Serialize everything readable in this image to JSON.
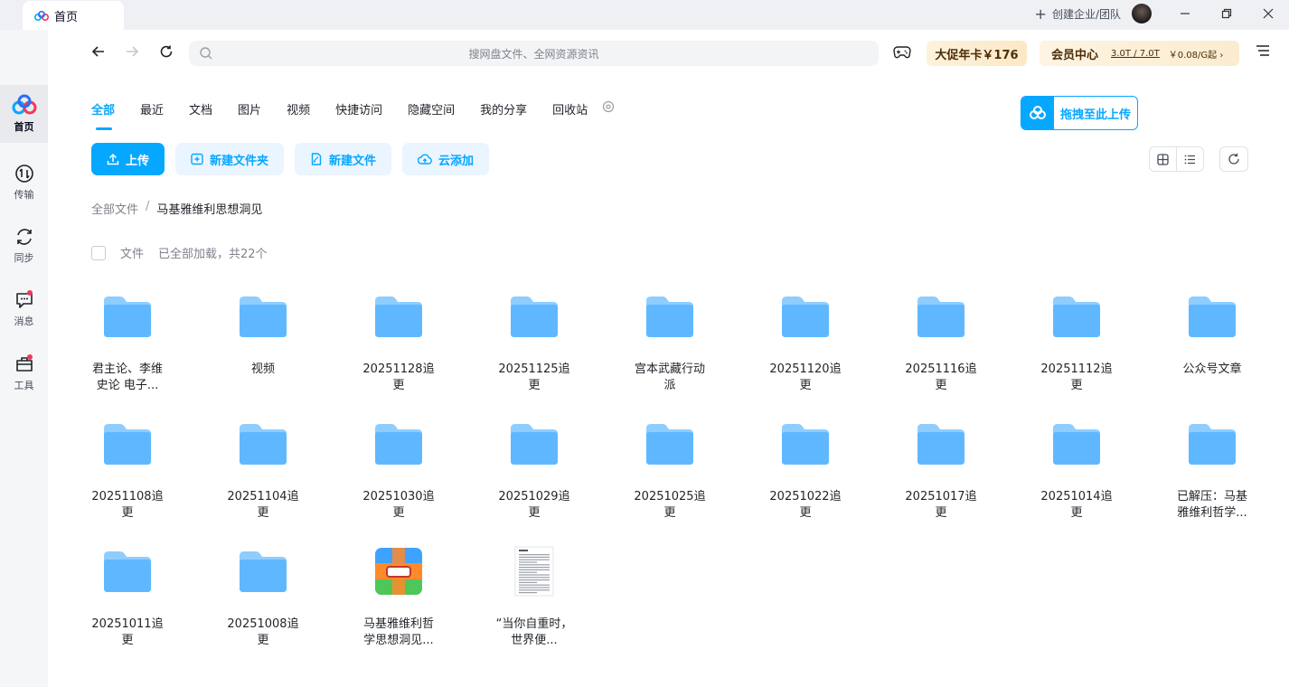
{
  "titlebar": {
    "tab_title": "首页",
    "create_enterprise": "创建企业/团队"
  },
  "sidebar": {
    "items": [
      {
        "label": "首页",
        "icon": "home-cloud-icon"
      },
      {
        "label": "传输",
        "icon": "transfer-icon"
      },
      {
        "label": "同步",
        "icon": "sync-icon"
      },
      {
        "label": "消息",
        "icon": "message-icon"
      },
      {
        "label": "工具",
        "icon": "toolbox-icon"
      }
    ]
  },
  "topbar": {
    "search_placeholder": "搜网盘文件、全网资源资讯",
    "promo_label": "大促年卡￥176",
    "vip_label": "会员中心",
    "vip_capacity": "3.0T / 7.0T",
    "vip_price": "￥0.08/G起 ›"
  },
  "tabs": [
    "全部",
    "最近",
    "文档",
    "图片",
    "视频",
    "快捷访问",
    "隐藏空间",
    "我的分享",
    "回收站"
  ],
  "drag_upload_label": "拖拽至此上传",
  "actions": {
    "upload": "上传",
    "new_folder": "新建文件夹",
    "new_file": "新建文件",
    "cloud_add": "云添加"
  },
  "breadcrumb": {
    "root": "全部文件",
    "separator": "/",
    "current": "马基雅维利思想洞见"
  },
  "list_header": {
    "column": "文件",
    "count": "已全部加载，共22个"
  },
  "files": [
    {
      "name": "君主论、李维史论 电子...",
      "type": "folder"
    },
    {
      "name": "视频",
      "type": "folder"
    },
    {
      "name": "20251128追更",
      "type": "folder"
    },
    {
      "name": "20251125追更",
      "type": "folder"
    },
    {
      "name": "宫本武藏行动派",
      "type": "folder"
    },
    {
      "name": "20251120追更",
      "type": "folder"
    },
    {
      "name": "20251116追更",
      "type": "folder"
    },
    {
      "name": "20251112追更",
      "type": "folder"
    },
    {
      "name": "公众号文章",
      "type": "folder"
    },
    {
      "name": "20251108追更",
      "type": "folder"
    },
    {
      "name": "20251104追更",
      "type": "folder"
    },
    {
      "name": "20251030追更",
      "type": "folder"
    },
    {
      "name": "20251029追更",
      "type": "folder"
    },
    {
      "name": "20251025追更",
      "type": "folder"
    },
    {
      "name": "20251022追更",
      "type": "folder"
    },
    {
      "name": "20251017追更",
      "type": "folder"
    },
    {
      "name": "20251014追更",
      "type": "folder"
    },
    {
      "name": "已解压：马基雅维利哲学...",
      "type": "folder"
    },
    {
      "name": "20251011追更",
      "type": "folder"
    },
    {
      "name": "20251008追更",
      "type": "folder"
    },
    {
      "name": "马基雅维利哲学思想洞见...",
      "type": "archive"
    },
    {
      "name": "“当你自重时，世界便...",
      "type": "document"
    }
  ],
  "colors": {
    "accent": "#06a7ff",
    "folder": "#5fb8ff",
    "badge": "#f2385b"
  }
}
